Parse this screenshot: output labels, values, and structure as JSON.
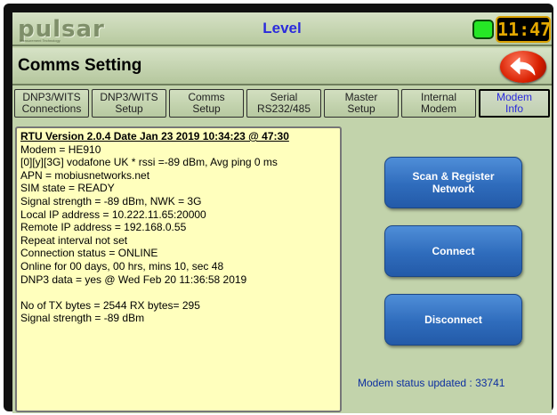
{
  "header": {
    "logo_text": "pulsar",
    "logo_sub": "Measurement Technology",
    "title": "Level",
    "clock": "11:47",
    "colors": {
      "accent": "#2a2adc",
      "led": "#26e626",
      "clock_text": "#e4a800"
    }
  },
  "screen": {
    "title": "Comms Setting",
    "back_icon": "back-arrow-icon"
  },
  "tabs": [
    {
      "line1": "DNP3/WITS",
      "line2": "Connections"
    },
    {
      "line1": "DNP3/WITS",
      "line2": "Setup"
    },
    {
      "line1": "Comms",
      "line2": "Setup"
    },
    {
      "line1": "Serial",
      "line2": "RS232/485"
    },
    {
      "line1": "Master",
      "line2": "Setup"
    },
    {
      "line1": "Internal",
      "line2": "Modem"
    },
    {
      "line1": "Modem",
      "line2": "Info"
    }
  ],
  "info": {
    "heading": "RTU Version 2.0.4 Date Jan 23 2019 10:34:23 @ 47:30",
    "lines": [
      "Modem = HE910",
      "[0][y][3G] vodafone UK  * rssi =-89 dBm, Avg ping 0 ms",
      "APN = mobiusnetworks.net",
      "SIM state =  READY",
      "Signal strength = -89 dBm, NWK = 3G",
      "Local IP address = 10.222.11.65:20000",
      "Remote IP address = 192.168.0.55",
      "Repeat interval not set",
      "Connection status = ONLINE",
      "Online for 00 days, 00 hrs, mins 10, sec 48",
      "DNP3 data = yes @ Wed Feb 20 11:36:58 2019",
      "",
      "No of TX bytes = 2544 RX bytes= 295",
      "Signal strength = -89 dBm"
    ]
  },
  "actions": {
    "scan_line1": "Scan & Register",
    "scan_line2": "Network",
    "connect": "Connect",
    "disconnect": "Disconnect"
  },
  "status": "Modem status updated : 33741"
}
